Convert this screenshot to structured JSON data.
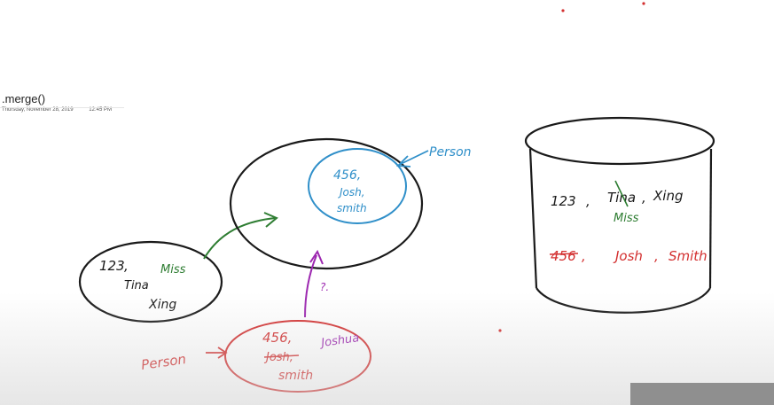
{
  "page": {
    "title": ".merge()",
    "date": "Thursday, November 28, 2019",
    "time": "12:45 PM"
  },
  "colors": {
    "ink_black": "#1a1a1a",
    "ink_blue": "#2f8fc9",
    "ink_green": "#2e7d32",
    "ink_red": "#d32f2f",
    "ink_purple": "#9c27b0"
  },
  "db_object": {
    "id": "123",
    "first": "Tina",
    "last": "Xing",
    "annotation": "Miss"
  },
  "context": {
    "label": "Person",
    "id": "456,",
    "first": "Josh,",
    "last": "smith"
  },
  "new_object": {
    "label": "Person",
    "id": "456,",
    "first": "Josh,",
    "last": "smith",
    "correction": "Joshua",
    "question": "?."
  },
  "database": {
    "row1": {
      "id": "123",
      "first": "Tina",
      "last": "Xing",
      "annotation": "Miss"
    },
    "row2": {
      "id": "456",
      "first": "Josh",
      "last": "Smith"
    }
  }
}
